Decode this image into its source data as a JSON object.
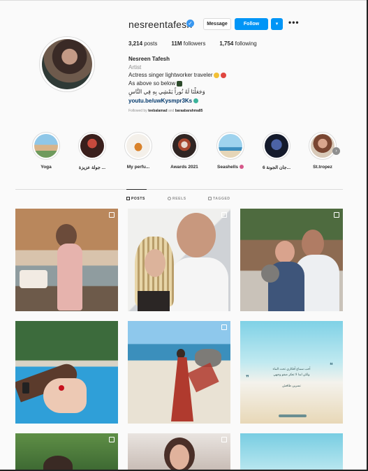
{
  "profile": {
    "username": "nesreentafesh",
    "verified_icon": "verified-badge-icon",
    "buttons": {
      "message": "Message",
      "follow": "Follow",
      "dropdown": "⌄",
      "more": "•••"
    },
    "stats": {
      "posts": "3,214",
      "posts_label": "posts",
      "followers": "11M",
      "followers_label": "followers",
      "following": "1,754",
      "following_label": "following"
    },
    "full_name": "Nesreen Tafesh",
    "category": "Artist",
    "bio_line1": "Actress singer lightworker traveler",
    "bio_line2": "As above so below",
    "bio_line3": "وَجَعَلْنَا لَهُ نُوراً يَمْشِي بِهِ فِي النَّاسِ",
    "link": "youtu.be/uwKysmpr3Ks",
    "followed_by_prefix": "Followed by",
    "followed_user1": "teebalamad",
    "followed_and": "and",
    "followed_user2": "baraabarahma85"
  },
  "highlights": [
    {
      "label": "Yoga"
    },
    {
      "label": "جولة عزيزة ..."
    },
    {
      "label": "My perfu..."
    },
    {
      "label": "Awards 2021"
    },
    {
      "label": "Seashells"
    },
    {
      "label": "جان الجونة 6..."
    },
    {
      "label": "St.tropez"
    }
  ],
  "tabs": {
    "posts": "POSTS",
    "reels": "REELS",
    "tagged": "TAGGED"
  },
  "quote_post": {
    "line1": "أحب سماع أفكاري تحت الماء",
    "line2": "ولكن ابدا لا تعكر صفو وجهي",
    "signature": "نسرين طافش"
  },
  "colors": {
    "accent": "#0095f6",
    "link": "#00376b",
    "muted": "#8e8e8e",
    "border": "#dbdbdb"
  }
}
